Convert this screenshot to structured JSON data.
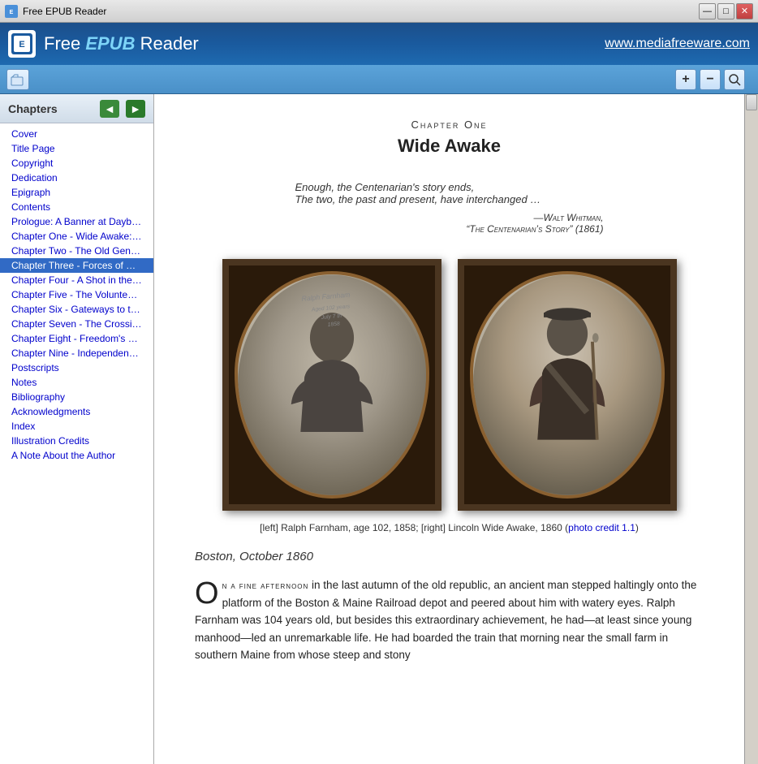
{
  "titlebar": {
    "title": "Free EPUB Reader",
    "icon": "📖",
    "minimize": "—",
    "maximize": "□",
    "close": "✕"
  },
  "header": {
    "logo_text": "Free EPUB Reader",
    "logo_bold": "EPUB",
    "website": "www.mediafreeware.com"
  },
  "toolbar": {
    "open_label": "📂",
    "zoom_in": "+",
    "zoom_out": "−",
    "zoom_fit": "⊙"
  },
  "sidebar": {
    "title": "Chapters",
    "prev": "◄",
    "next": "►",
    "items": [
      {
        "label": "Cover",
        "active": false
      },
      {
        "label": "Title Page",
        "active": false
      },
      {
        "label": "Copyright",
        "active": false
      },
      {
        "label": "Dedication",
        "active": false
      },
      {
        "label": "Epigraph",
        "active": false
      },
      {
        "label": "Contents",
        "active": false
      },
      {
        "label": "Prologue: A Banner at Daybreak: C",
        "active": false
      },
      {
        "label": "Chapter One - Wide Awake: Bosto",
        "active": false
      },
      {
        "label": "Chapter Two - The Old Gentlemen",
        "active": false
      },
      {
        "label": "Chapter Three - Forces of Nature:",
        "active": true
      },
      {
        "label": "Chapter Four - A Shot in the Dark:",
        "active": false
      },
      {
        "label": "Chapter Five - The Volunteer: Low",
        "active": false
      },
      {
        "label": "Chapter Six - Gateways to the Wes",
        "active": false
      },
      {
        "label": "Chapter Seven - The Crossing: Wa",
        "active": false
      },
      {
        "label": "Chapter Eight - Freedom's Fortress",
        "active": false
      },
      {
        "label": "Chapter Nine - Independence Day",
        "active": false
      },
      {
        "label": "Postscripts",
        "active": false
      },
      {
        "label": "Notes",
        "active": false
      },
      {
        "label": "Bibliography",
        "active": false
      },
      {
        "label": "Acknowledgments",
        "active": false
      },
      {
        "label": "Index",
        "active": false
      },
      {
        "label": "Illustration Credits",
        "active": false
      },
      {
        "label": "A Note About the Author",
        "active": false
      }
    ]
  },
  "content": {
    "chapter_label": "Chapter One",
    "chapter_title": "Wide Awake",
    "epigraph_line1": "Enough, the Centenarian's story ends,",
    "epigraph_line2": "The two, the past and present, have interchanged …",
    "epigraph_attribution_line1": "—Walt Whitman,",
    "epigraph_attribution_line2": "“The Centenarian’s Story” (1861)",
    "photo_caption": "[left] Ralph Farnham, age 102, 1858; [right] Lincoln Wide Awake, 1860 (",
    "photo_credit": "photo credit 1.1",
    "photo_caption_end": ")",
    "location": "Boston, October 1860",
    "body_dropcap": "O",
    "body_start": "n a fine afternoon",
    "body_text1": " in the last autumn of the old republic, an ancient man stepped haltingly onto the platform of the Boston & Maine Railroad depot and peered about him with watery eyes. Ralph Farnham was 104 years old, but besides this extraordinary achievement, he had—at least since young manhood—led an unremarkable life. He had boarded the train that morning near the small farm in southern Maine from whose steep and stony"
  }
}
